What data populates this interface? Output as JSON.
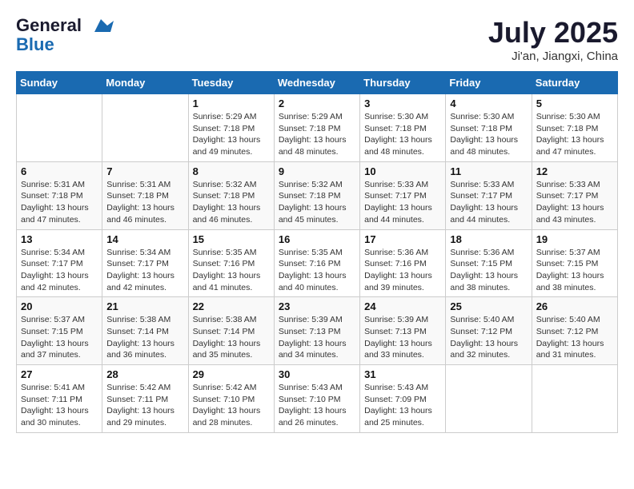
{
  "header": {
    "logo_line1": "General",
    "logo_line2": "Blue",
    "month_title": "July 2025",
    "location": "Ji'an, Jiangxi, China"
  },
  "days_of_week": [
    "Sunday",
    "Monday",
    "Tuesday",
    "Wednesday",
    "Thursday",
    "Friday",
    "Saturday"
  ],
  "weeks": [
    [
      {
        "day": "",
        "info": ""
      },
      {
        "day": "",
        "info": ""
      },
      {
        "day": "1",
        "info": "Sunrise: 5:29 AM\nSunset: 7:18 PM\nDaylight: 13 hours and 49 minutes."
      },
      {
        "day": "2",
        "info": "Sunrise: 5:29 AM\nSunset: 7:18 PM\nDaylight: 13 hours and 48 minutes."
      },
      {
        "day": "3",
        "info": "Sunrise: 5:30 AM\nSunset: 7:18 PM\nDaylight: 13 hours and 48 minutes."
      },
      {
        "day": "4",
        "info": "Sunrise: 5:30 AM\nSunset: 7:18 PM\nDaylight: 13 hours and 48 minutes."
      },
      {
        "day": "5",
        "info": "Sunrise: 5:30 AM\nSunset: 7:18 PM\nDaylight: 13 hours and 47 minutes."
      }
    ],
    [
      {
        "day": "6",
        "info": "Sunrise: 5:31 AM\nSunset: 7:18 PM\nDaylight: 13 hours and 47 minutes."
      },
      {
        "day": "7",
        "info": "Sunrise: 5:31 AM\nSunset: 7:18 PM\nDaylight: 13 hours and 46 minutes."
      },
      {
        "day": "8",
        "info": "Sunrise: 5:32 AM\nSunset: 7:18 PM\nDaylight: 13 hours and 46 minutes."
      },
      {
        "day": "9",
        "info": "Sunrise: 5:32 AM\nSunset: 7:18 PM\nDaylight: 13 hours and 45 minutes."
      },
      {
        "day": "10",
        "info": "Sunrise: 5:33 AM\nSunset: 7:17 PM\nDaylight: 13 hours and 44 minutes."
      },
      {
        "day": "11",
        "info": "Sunrise: 5:33 AM\nSunset: 7:17 PM\nDaylight: 13 hours and 44 minutes."
      },
      {
        "day": "12",
        "info": "Sunrise: 5:33 AM\nSunset: 7:17 PM\nDaylight: 13 hours and 43 minutes."
      }
    ],
    [
      {
        "day": "13",
        "info": "Sunrise: 5:34 AM\nSunset: 7:17 PM\nDaylight: 13 hours and 42 minutes."
      },
      {
        "day": "14",
        "info": "Sunrise: 5:34 AM\nSunset: 7:17 PM\nDaylight: 13 hours and 42 minutes."
      },
      {
        "day": "15",
        "info": "Sunrise: 5:35 AM\nSunset: 7:16 PM\nDaylight: 13 hours and 41 minutes."
      },
      {
        "day": "16",
        "info": "Sunrise: 5:35 AM\nSunset: 7:16 PM\nDaylight: 13 hours and 40 minutes."
      },
      {
        "day": "17",
        "info": "Sunrise: 5:36 AM\nSunset: 7:16 PM\nDaylight: 13 hours and 39 minutes."
      },
      {
        "day": "18",
        "info": "Sunrise: 5:36 AM\nSunset: 7:15 PM\nDaylight: 13 hours and 38 minutes."
      },
      {
        "day": "19",
        "info": "Sunrise: 5:37 AM\nSunset: 7:15 PM\nDaylight: 13 hours and 38 minutes."
      }
    ],
    [
      {
        "day": "20",
        "info": "Sunrise: 5:37 AM\nSunset: 7:15 PM\nDaylight: 13 hours and 37 minutes."
      },
      {
        "day": "21",
        "info": "Sunrise: 5:38 AM\nSunset: 7:14 PM\nDaylight: 13 hours and 36 minutes."
      },
      {
        "day": "22",
        "info": "Sunrise: 5:38 AM\nSunset: 7:14 PM\nDaylight: 13 hours and 35 minutes."
      },
      {
        "day": "23",
        "info": "Sunrise: 5:39 AM\nSunset: 7:13 PM\nDaylight: 13 hours and 34 minutes."
      },
      {
        "day": "24",
        "info": "Sunrise: 5:39 AM\nSunset: 7:13 PM\nDaylight: 13 hours and 33 minutes."
      },
      {
        "day": "25",
        "info": "Sunrise: 5:40 AM\nSunset: 7:12 PM\nDaylight: 13 hours and 32 minutes."
      },
      {
        "day": "26",
        "info": "Sunrise: 5:40 AM\nSunset: 7:12 PM\nDaylight: 13 hours and 31 minutes."
      }
    ],
    [
      {
        "day": "27",
        "info": "Sunrise: 5:41 AM\nSunset: 7:11 PM\nDaylight: 13 hours and 30 minutes."
      },
      {
        "day": "28",
        "info": "Sunrise: 5:42 AM\nSunset: 7:11 PM\nDaylight: 13 hours and 29 minutes."
      },
      {
        "day": "29",
        "info": "Sunrise: 5:42 AM\nSunset: 7:10 PM\nDaylight: 13 hours and 28 minutes."
      },
      {
        "day": "30",
        "info": "Sunrise: 5:43 AM\nSunset: 7:10 PM\nDaylight: 13 hours and 26 minutes."
      },
      {
        "day": "31",
        "info": "Sunrise: 5:43 AM\nSunset: 7:09 PM\nDaylight: 13 hours and 25 minutes."
      },
      {
        "day": "",
        "info": ""
      },
      {
        "day": "",
        "info": ""
      }
    ]
  ]
}
